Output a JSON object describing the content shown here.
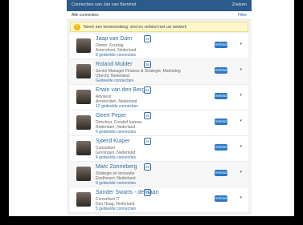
{
  "topbar": {
    "left": "Connecties van Jan van Bemmel",
    "right": "Zoeken"
  },
  "subbar": {
    "left": "Alle connecties",
    "right": "Filter"
  },
  "notice": {
    "icon": "info-icon",
    "text": "Neem een kennismaking: vind en verbind met uw netwerk"
  },
  "people": [
    {
      "name": "Jaap van Dam",
      "degree": "2e",
      "line1": "Owner, Fourtag",
      "line2": "Amersfoort, Nederland",
      "line3": "8 gedeelde connecties",
      "button": "Verbind",
      "more": "▾"
    },
    {
      "name": "Roland Mulder",
      "degree": "2e",
      "line1": "Senior Manager Finance & Strategie, Marketing",
      "line2": "Utrecht, Nederland",
      "line3": "Gedeelde connecties",
      "button": "Verbind",
      "more": "▾"
    },
    {
      "name": "Erwin van den Berg",
      "degree": "2e",
      "line1": "Adviseur",
      "line2": "Amsterdam, Nederland",
      "line3": "12 gedeelde connecties",
      "button": "Verbind",
      "more": "▾"
    },
    {
      "name": "Geert Peper",
      "degree": "2e",
      "line1": "Directeur, Creatief bureau",
      "line2": "Rotterdam, Nederland",
      "line3": "6 gedeelde connecties",
      "button": "Verbind",
      "more": "▾"
    },
    {
      "name": "Sjoerd Kuiper",
      "degree": "2e",
      "line1": "Consultant",
      "line2": "Groningen, Nederland",
      "line3": "4 gedeelde connecties",
      "button": "Verbind",
      "more": "▾"
    },
    {
      "name": "Marc Zonneberg",
      "degree": "2e",
      "line1": "Strategie en innovatie",
      "line2": "Eindhoven, Nederland",
      "line3": "9 gedeelde connecties",
      "button": "Verbind",
      "more": "▾"
    },
    {
      "name": "Sander Swarts - de Haan",
      "degree": "2e",
      "line1": "Consultant IT",
      "line2": "Den Haag, Nederland",
      "line3": "5 gedeelde connecties",
      "button": "Verbind",
      "more": "▾"
    }
  ]
}
